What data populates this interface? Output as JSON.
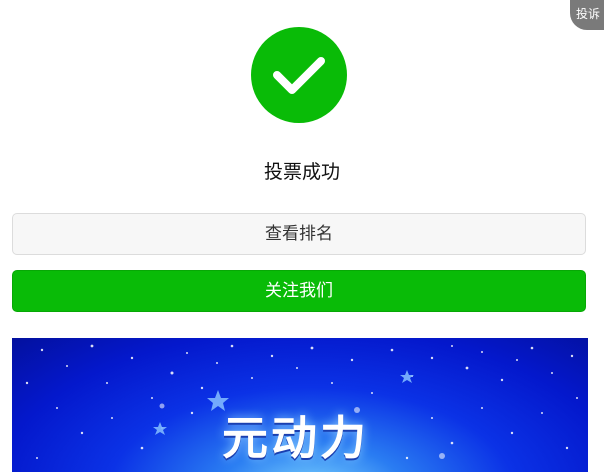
{
  "complain": {
    "label": "投诉"
  },
  "result": {
    "status_text": "投票成功"
  },
  "actions": {
    "view_ranking_label": "查看排名",
    "follow_us_label": "关注我们"
  },
  "banner": {
    "title": "元动力"
  },
  "colors": {
    "success_green": "#09bb07",
    "secondary_button_bg": "#f7f7f7",
    "complain_badge_bg": "#7a7a7a",
    "banner_blue": "#0b32e6"
  },
  "icons": {
    "success": "check-circle-icon"
  }
}
